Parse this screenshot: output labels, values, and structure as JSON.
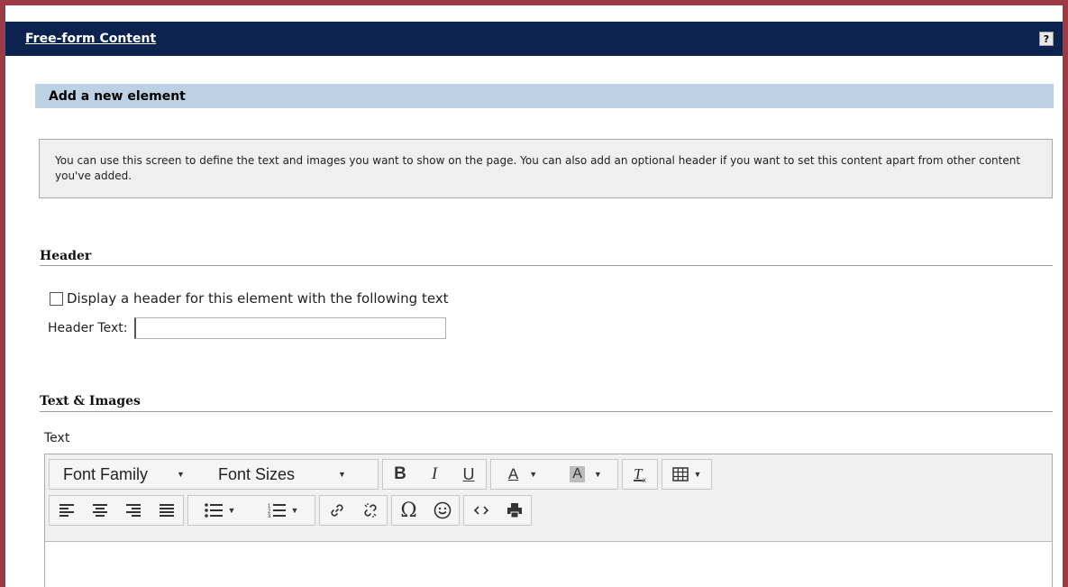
{
  "window": {
    "title": "Free-form Content",
    "help_label": "?"
  },
  "section": {
    "title": "Add a new element"
  },
  "info": {
    "text": "You can use this screen to define the text and images you want to show on the page. You can also add an optional header if you want to set this content apart from other content you've added."
  },
  "header_group": {
    "title": "Header",
    "checkbox_label": "Display a header for this element with the following text",
    "checkbox_checked": false,
    "field_label": "Header Text:",
    "field_value": ""
  },
  "text_group": {
    "title": "Text & Images",
    "editor_label": "Text"
  },
  "toolbar": {
    "font_family": "Font Family",
    "font_sizes": "Font Sizes",
    "bold": "B",
    "italic": "I",
    "underline": "U",
    "text_color": "A",
    "bg_color": "A",
    "special_char": "Ω"
  },
  "colors": {
    "title_bar": "#0c2350",
    "frame": "#9c3b45",
    "section_bar": "#bdd1e4"
  }
}
